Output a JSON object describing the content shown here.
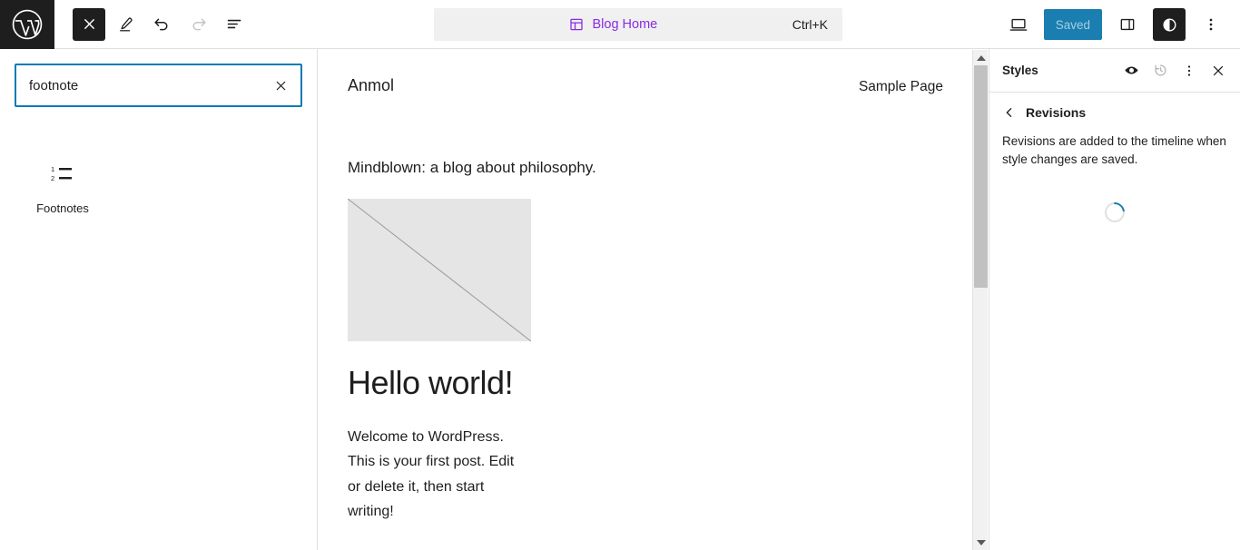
{
  "topbar": {
    "logo_icon": "wordpress-logo-icon",
    "close_icon": "close-icon",
    "edit_icon": "pencil-edit-icon",
    "undo_icon": "undo-icon",
    "redo_icon": "redo-icon",
    "overview_icon": "document-overview-icon",
    "command_center": {
      "icon": "template-layout-icon",
      "label": "Blog Home",
      "shortcut": "Ctrl+K",
      "accent_color": "#8a2be2"
    },
    "view_icon": "desktop-view-icon",
    "save_label": "Saved",
    "save_color": "#1a7eb0",
    "settings_icon": "sidebar-panel-icon",
    "styles_icon": "contrast-styles-icon",
    "options_icon": "three-dots-vertical-icon"
  },
  "inserter": {
    "search": {
      "value": "footnote",
      "placeholder": "Search",
      "clear_icon": "close-icon",
      "border_color": "#0b7ab5"
    },
    "results": [
      {
        "label": "Footnotes",
        "icon": "ordered-list-icon"
      }
    ]
  },
  "canvas": {
    "site_title": "Anmol",
    "nav_item": "Sample Page",
    "tagline": "Mindblown: a blog about philosophy.",
    "post": {
      "featured_image_alt": "broken-image-placeholder",
      "title": "Hello world!",
      "body": "Welcome to WordPress. This is your first post. Edit or delete it, then start writing!"
    },
    "scrollbar": {
      "up_icon": "scroll-up-arrow-icon",
      "down_icon": "scroll-down-arrow-icon"
    }
  },
  "styles_panel": {
    "title": "Styles",
    "preview_icon": "eye-style-book-icon",
    "revisions_icon": "revisions-history-icon",
    "options_icon": "three-dots-vertical-icon",
    "close_icon": "close-icon",
    "back_icon": "chevron-left-icon",
    "section_title": "Revisions",
    "description": "Revisions are added to the timeline when style changes are saved.",
    "loading_icon": "loading-spinner-icon",
    "spinner_color": "#1a7eb0"
  }
}
